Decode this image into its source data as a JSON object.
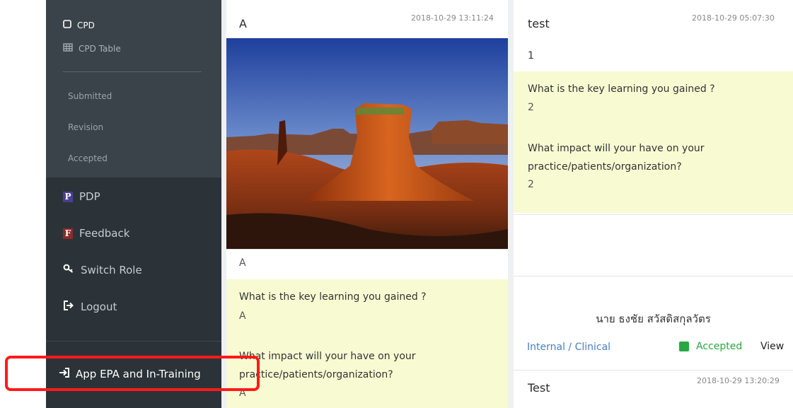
{
  "sidebar": {
    "cpd_label": "CPD",
    "cpd_table_label": "CPD Table",
    "submitted_label": "Submitted",
    "revision_label": "Revision",
    "accepted_label": "Accepted",
    "pdp_badge": "P",
    "pdp_label": "PDP",
    "feedback_badge": "F",
    "feedback_label": "Feedback",
    "switch_role_label": "Switch Role",
    "logout_label": "Logout",
    "app_epa_label": "App EPA and In-Training"
  },
  "card1": {
    "title": "A",
    "date": "2018-10-29 13:11:24",
    "caption": "A",
    "q1": "What is the key learning you gained ?",
    "a1": "A",
    "q2_line1": "What impact will your have on your",
    "q2_line2": "practice/patients/organization?",
    "a2": "A"
  },
  "card2": {
    "title": "test",
    "date": "2018-10-29 05:07:30",
    "value": "1",
    "q1": "What is the key learning you gained ?",
    "a1": "2",
    "q2_line1": "What impact will your have on your",
    "q2_line2": "practice/patients/organization?",
    "a2": "2"
  },
  "card3": {
    "name": "นาย ธงชัย สวัสดิสกุลวัตร",
    "category": "Internal / Clinical",
    "status": "Accepted",
    "view_label": "View",
    "next_title": "Test",
    "next_date": "2018-10-29 13:20:29"
  },
  "colors": {
    "sidebar": "#2b3338",
    "highlight": "#f8fbd2",
    "accepted": "#27a844",
    "annotation": "#ff1a1a"
  }
}
